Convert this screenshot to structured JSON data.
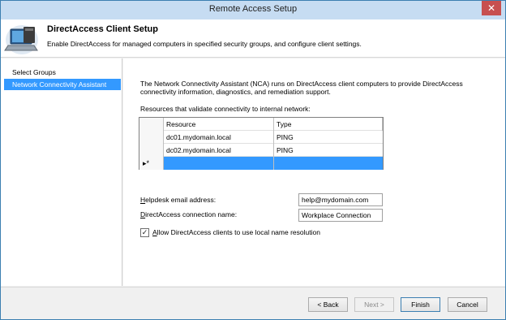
{
  "window": {
    "title": "Remote Access Setup",
    "close_glyph": "✕"
  },
  "header": {
    "title": "DirectAccess Client Setup",
    "subtitle": "Enable DirectAccess for managed computers in specified security groups, and configure client settings.",
    "icon": "computer-icon"
  },
  "nav": {
    "items": [
      {
        "label": "Select Groups",
        "selected": false
      },
      {
        "label": "Network Connectivity Assistant",
        "selected": true
      }
    ]
  },
  "content": {
    "description": "The Network Connectivity Assistant (NCA) runs on DirectAccess client computers to provide DirectAccess connectivity information, diagnostics, and remediation support.",
    "resources_label": "Resources that validate connectivity to internal network:",
    "grid": {
      "columns": [
        "Resource",
        "Type"
      ],
      "rows": [
        {
          "resource": "dc01.mydomain.local",
          "type": "PING"
        },
        {
          "resource": "dc02.mydomain.local",
          "type": "PING"
        }
      ],
      "new_row_glyph": "▸*"
    },
    "helpdesk_label_first": "H",
    "helpdesk_label_rest": "elpdesk email address:",
    "helpdesk_value": "help@mydomain.com",
    "connection_label_first": "D",
    "connection_label_rest": "irectAccess connection name:",
    "connection_value": "Workplace Connection",
    "local_name_checkbox": {
      "checked": true,
      "check_glyph": "✓",
      "label_first": "A",
      "label_rest": "llow DirectAccess clients to use local name resolution"
    }
  },
  "footer": {
    "back": "< Back",
    "next": "Next >",
    "finish": "Finish",
    "cancel": "Cancel"
  },
  "colors": {
    "selection": "#3399ff",
    "titlebar": "#c6dcf2",
    "close": "#c75050"
  }
}
